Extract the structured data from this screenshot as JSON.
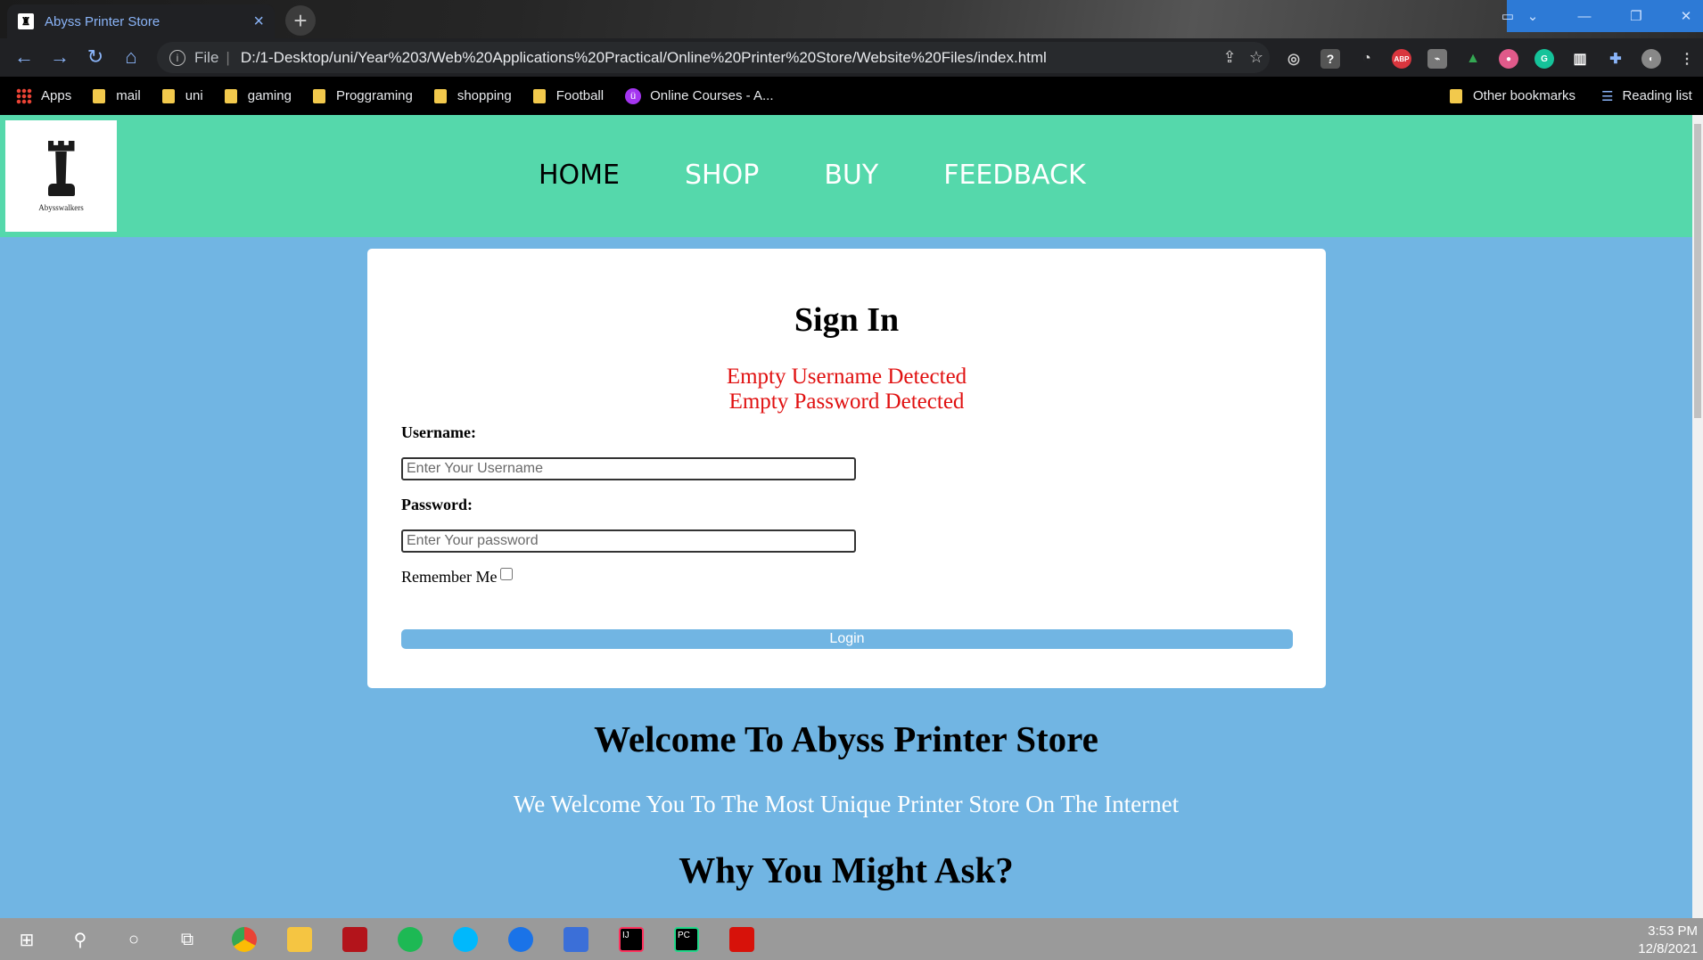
{
  "browser": {
    "tab_title": "Abyss Printer Store",
    "tab_close": "×",
    "new_tab": "+",
    "address_scheme": "File",
    "address_sep": "|",
    "url": "D:/1-Desktop/uni/Year%203/Web%20Applications%20Practical/Online%20Printer%20Store/Website%20Files/index.html",
    "extension_labels": [
      "ABP",
      "IJ",
      "PC"
    ]
  },
  "bookmarks": {
    "items": [
      "Apps",
      "mail",
      "uni",
      "gaming",
      "Proggraming",
      "shopping",
      "Football",
      "Online Courses - A..."
    ],
    "other": "Other bookmarks",
    "reading_list": "Reading list"
  },
  "site": {
    "logo_text": "Abysswalkers",
    "nav": [
      "HOME",
      "SHOP",
      "BUY",
      "FEEDBACK"
    ],
    "active_nav": "HOME",
    "header_color": "#55d8ab",
    "page_color": "#71b5e3"
  },
  "signin": {
    "title": "Sign In",
    "errors": [
      "Empty Username Detected",
      "Empty Password Detected"
    ],
    "username_label": "Username:",
    "username_placeholder": "Enter Your Username",
    "password_label": "Password:",
    "password_placeholder": "Enter Your password",
    "remember_label": "Remember Me",
    "remember_checked": false,
    "login_label": "Login",
    "error_color": "#e01010"
  },
  "welcome": {
    "title": "Welcome To Abyss Printer Store",
    "subtitle": "We Welcome You To The Most Unique Printer Store On The Internet",
    "why": "Why You Might Ask?"
  },
  "taskbar": {
    "time": "3:53 PM",
    "date": "12/8/2021"
  }
}
